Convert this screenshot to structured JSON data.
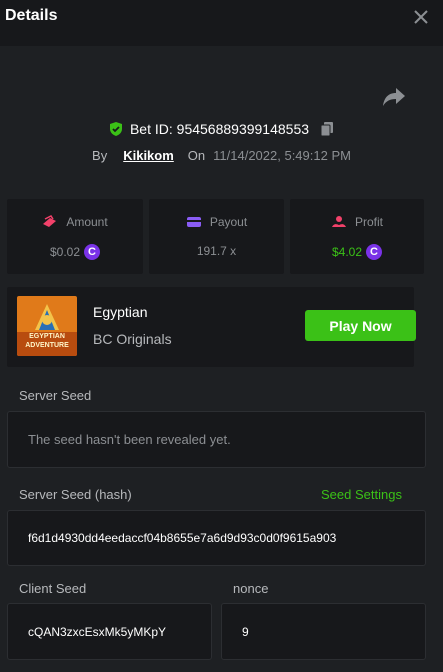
{
  "header": {
    "title": "Details"
  },
  "bet": {
    "id_text": "Bet ID: 95456889399148553",
    "by_label": "By",
    "user": "Kikikom",
    "on_label": "On",
    "date": "11/14/2022, 5:49:12 PM"
  },
  "stats": {
    "amount_label": "Amount",
    "amount_value": "$0.02",
    "payout_label": "Payout",
    "payout_value": "191.7 x",
    "profit_label": "Profit",
    "profit_value": "$4.02"
  },
  "game": {
    "thumb_text_1": "EGYPTIAN",
    "thumb_text_2": "ADVENTURE",
    "name": "Egyptian",
    "provider": "BC Originals",
    "play_label": "Play Now"
  },
  "seeds": {
    "server_seed_label": "Server Seed",
    "server_seed_text": "The seed hasn't been revealed yet.",
    "server_hash_label": "Server Seed (hash)",
    "seed_settings_label": "Seed Settings",
    "server_hash_value": "f6d1d4930dd4eedaccf04b8655e7a6d9d93c0d0f9615a903",
    "client_seed_label": "Client Seed",
    "client_seed_value": "cQAN3zxcEsxMk5yMKpY",
    "nonce_label": "nonce",
    "nonce_value": "9"
  },
  "colors": {
    "accent_green": "#3bc117",
    "coin_purple": "#7a32e8",
    "profit_green": "#3bc117"
  },
  "icons": [
    "close-icon",
    "share-icon",
    "shield-check-icon",
    "copy-icon",
    "amount-icon",
    "payout-icon",
    "profit-icon",
    "coin-icon"
  ]
}
